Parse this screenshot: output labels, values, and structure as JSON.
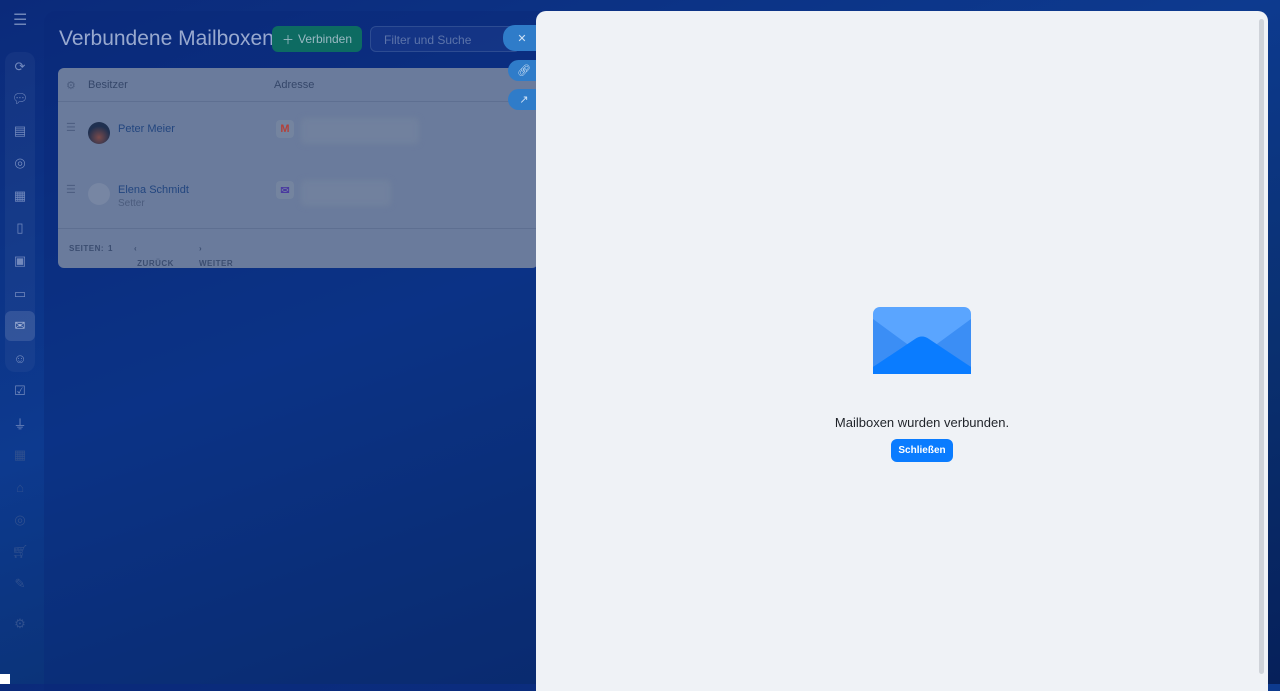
{
  "page": {
    "title": "Verbundene Mailboxen",
    "connect_label": "Verbinden",
    "filter_placeholder": "Filter und Suche"
  },
  "table": {
    "columns": [
      "Besitzer",
      "Adresse"
    ],
    "rows": [
      {
        "name": "Peter Meier",
        "role": "",
        "provider": "gmail"
      },
      {
        "name": "Elena Schmidt",
        "role": "Setter",
        "provider": "mail"
      }
    ],
    "pager": {
      "pages_label": "SEITEN:",
      "page": "1",
      "prev": "ZURÜCK",
      "next": "WEITER"
    }
  },
  "slider": {
    "message": "Mailboxen wurden verbunden.",
    "close_label": "Schließen"
  },
  "colors": {
    "accent": "#0a7cff",
    "envelope_light": "#5aa5ff",
    "envelope_dark": "#0a7cff"
  }
}
